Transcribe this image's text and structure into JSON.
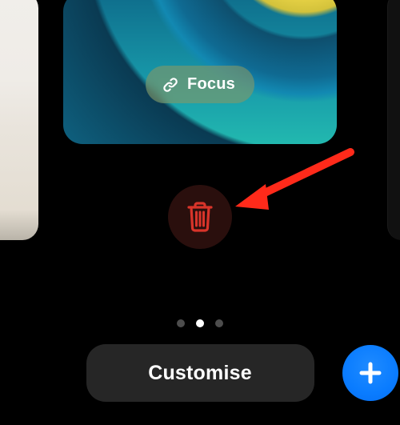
{
  "focus": {
    "label": "Focus"
  },
  "buttons": {
    "customise": "Customise"
  },
  "pagination": {
    "count": 3,
    "active": 1
  },
  "colors": {
    "accent_blue": "#0a7cff",
    "trash_red": "#d8342a",
    "trash_bg": "#2a0f0d"
  }
}
